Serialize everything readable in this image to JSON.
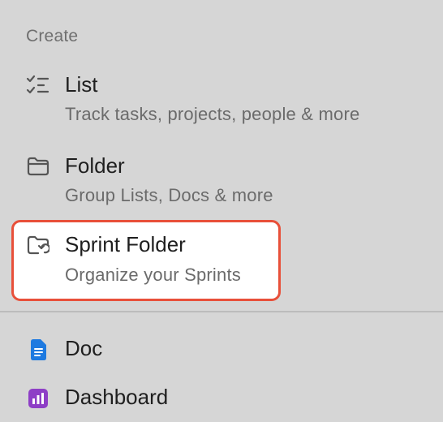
{
  "menu": {
    "section_title": "Create",
    "items": [
      {
        "title": "List",
        "description": "Track tasks, projects, people & more",
        "icon": "checklist-icon"
      },
      {
        "title": "Folder",
        "description": "Group Lists, Docs & more",
        "icon": "folder-icon"
      },
      {
        "title": "Sprint Folder",
        "description": "Organize your Sprints",
        "icon": "sprint-folder-icon",
        "highlighted": true
      },
      {
        "title": "Doc",
        "icon": "doc-icon"
      },
      {
        "title": "Dashboard",
        "icon": "dashboard-icon"
      }
    ]
  },
  "colors": {
    "background": "#d6d6d6",
    "highlight_border": "#e8503a",
    "doc_icon": "#1e7ae0",
    "dashboard_icon": "#8e3ec6"
  }
}
